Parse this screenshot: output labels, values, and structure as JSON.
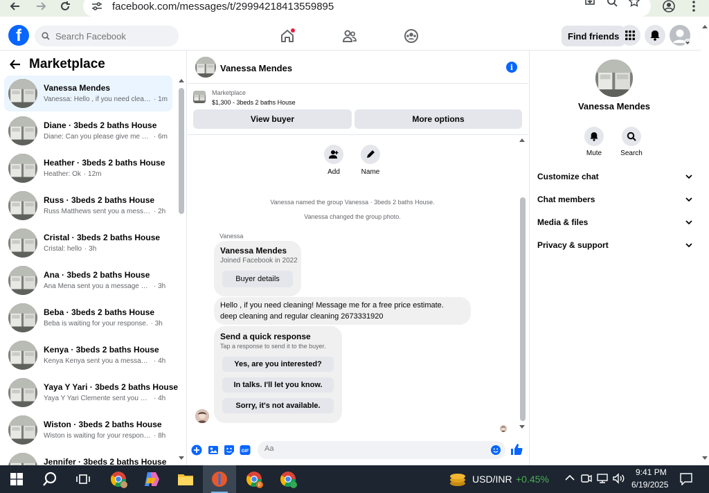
{
  "browser": {
    "url": "facebook.com/messages/t/29994218413559895"
  },
  "header": {
    "logo": "f",
    "search_placeholder": "Search Facebook",
    "find_friends": "Find friends"
  },
  "sidebar": {
    "title": "Marketplace",
    "conversations": [
      {
        "name": "Vanessa Mendes",
        "preview": "Vanessa: Hello , if you need cleani...",
        "time": "1m",
        "active": true
      },
      {
        "name": "Diane · 3beds 2 baths House",
        "preview": "Diane: Can you please give me a ...",
        "time": "6m"
      },
      {
        "name": "Heather · 3beds 2 baths House",
        "preview": "Heather: Ok",
        "time": "12m"
      },
      {
        "name": "Russ · 3beds 2 baths House",
        "preview": "Russ Matthews sent you a messag...",
        "time": "2h"
      },
      {
        "name": "Cristal · 3beds 2 baths House",
        "preview": "Cristal: hello",
        "time": "3h"
      },
      {
        "name": "Ana · 3beds 2 baths House",
        "preview": "Ana Mena sent you a message ab...",
        "time": "3h"
      },
      {
        "name": "Beba · 3beds 2 baths House",
        "preview": "Beba is waiting for your response.",
        "time": "3h"
      },
      {
        "name": "Kenya · 3beds 2 baths House",
        "preview": "Kenya Kenya sent you a message ...",
        "time": "4h"
      },
      {
        "name": "Yaya Y Yari · 3beds 2 baths House",
        "preview": "Yaya Y Yari Clemente sent you a m...",
        "time": "4h"
      },
      {
        "name": "Wiston · 3beds 2 baths House",
        "preview": "Wiston is waiting for your response.",
        "time": "8h"
      },
      {
        "name": "Jennifer · 3beds 2 baths House",
        "preview": "",
        "time": ""
      }
    ]
  },
  "chat": {
    "name": "Vanessa Mendes",
    "listing_label": "Marketplace",
    "listing_title": "$1,300 - 3beds 2 baths House",
    "view_buyer": "View buyer",
    "more_options": "More options",
    "actions": {
      "add": "Add",
      "name": "Name"
    },
    "system_messages": [
      "Vanessa named the group Vanessa · 3beds 2 baths House.",
      "Vanessa changed the group photo."
    ],
    "sender_label": "Vanessa",
    "profile_card": {
      "name": "Vanessa Mendes",
      "joined": "Joined Facebook in 2022",
      "button": "Buyer details"
    },
    "message_line1": "Hello , if you need cleaning! Message me for a free price estimate.",
    "message_line2": "deep cleaning and regular cleaning 2673331920",
    "quick": {
      "title": "Send a quick response",
      "subtitle": "Tap a response to send it to the buyer.",
      "options": [
        "Yes, are you interested?",
        "In talks. I'll let you know.",
        "Sorry, it's not available."
      ]
    },
    "composer_placeholder": "Aa"
  },
  "details": {
    "name": "Vanessa Mendes",
    "mute": "Mute",
    "search": "Search",
    "sections": [
      "Customize chat",
      "Chat members",
      "Media & files",
      "Privacy & support"
    ]
  },
  "taskbar": {
    "ticker": "USD/INR",
    "change": "+0.45%",
    "time": "9:41 PM",
    "date": "6/19/2025"
  },
  "colors": {
    "brand": "#0866ff",
    "active_row": "#ebf5ff",
    "taskbar": "#1c2530",
    "ticker_up": "#4caf50"
  }
}
